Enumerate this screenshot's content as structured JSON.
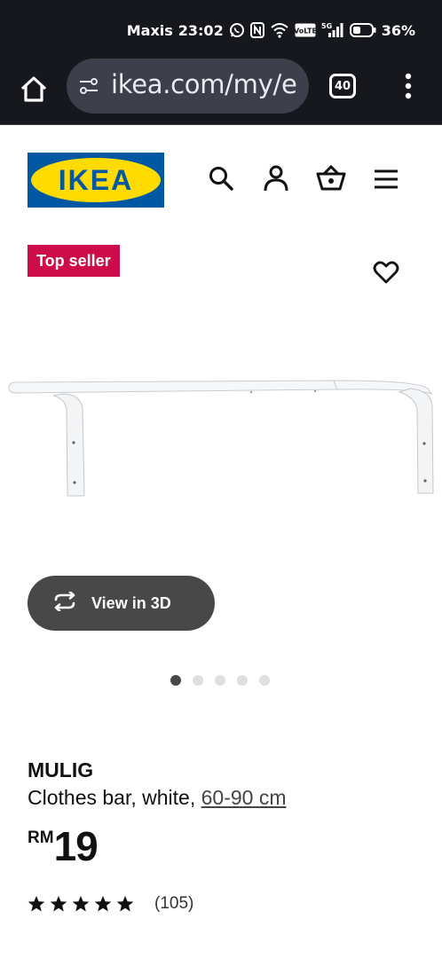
{
  "status": {
    "carrier": "Maxis",
    "time": "23:02",
    "network_badge": "VoLTE",
    "signal_type": "5G",
    "battery_percent": "36%",
    "icons": [
      "whatsapp-icon",
      "nfc-icon",
      "wifi-icon",
      "volte-icon",
      "signal-icon",
      "battery-icon"
    ]
  },
  "browser": {
    "url": "ikea.com/my/e",
    "tab_count": "40"
  },
  "header": {
    "logo_text": "IKEA",
    "brand_colors": {
      "blue": "#0058a3",
      "yellow": "#ffdb00"
    },
    "icons": [
      "search-icon",
      "user-icon",
      "basket-icon",
      "hamburger-menu-icon"
    ]
  },
  "media": {
    "badge": "Top seller",
    "view3d_label": "View in 3D",
    "carousel": {
      "total": 5,
      "active": 1
    }
  },
  "product": {
    "name": "MULIG",
    "description": "Clothes bar, white,",
    "size": "60-90 cm",
    "currency": "RM",
    "price": "19",
    "rating_stars": 5,
    "review_count": "(105)"
  },
  "colors": {
    "topbar_bg": "#16181d",
    "badge_red": "#cc0d4a",
    "button_dark": "#484848"
  }
}
